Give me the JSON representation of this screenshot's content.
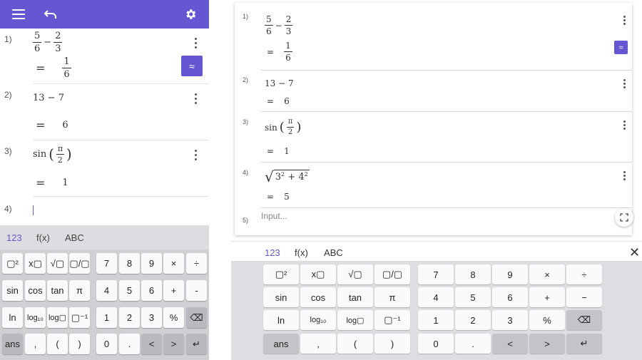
{
  "colors": {
    "accent": "#6557d2",
    "key_bg": "#fafafa",
    "key_dark": "#b9b9bf"
  },
  "icons": {
    "menu": "hamburger-icon",
    "undo": "undo-icon",
    "settings": "gear-icon",
    "more": "kebab-icon",
    "approx": "approx-icon",
    "backspace": "backspace-icon",
    "enter": "enter-icon",
    "expand": "fullscreen-icon",
    "close": "close-icon"
  },
  "mobile": {
    "rows": [
      {
        "num": "1)",
        "equals": "=",
        "expr": {
          "a_num": "5",
          "a_den": "6",
          "op": "−",
          "b_num": "2",
          "b_den": "3"
        },
        "result": {
          "num": "1",
          "den": "6"
        }
      },
      {
        "num": "2)",
        "equals": "=",
        "expr": "13 − 7",
        "result": "6"
      },
      {
        "num": "3)",
        "equals": "=",
        "expr": {
          "fn": "sin",
          "num": "π",
          "den": "2"
        },
        "result": "1"
      },
      {
        "num": "4)"
      }
    ],
    "approx_label": "≈",
    "tabs": [
      "123",
      "f(x)",
      "ABC"
    ],
    "keys": {
      "r1": [
        "▢²",
        "x▢",
        "√▢",
        "▢/▢",
        "7",
        "8",
        "9",
        "×",
        "÷"
      ],
      "r2": [
        "sin",
        "cos",
        "tan",
        "π",
        "4",
        "5",
        "6",
        "+",
        "-"
      ],
      "r3": [
        "ln",
        "log₁₀",
        "log▢",
        "▢⁻¹",
        "1",
        "2",
        "3",
        "%",
        "⌫"
      ],
      "r4": [
        "ans",
        ",",
        "(",
        ")",
        "0",
        ".",
        "<",
        ">",
        "↵"
      ]
    }
  },
  "desktop": {
    "rows": [
      {
        "num": "1)",
        "equals": "=",
        "expr": {
          "a_num": "5",
          "a_den": "6",
          "op": "−",
          "b_num": "2",
          "b_den": "3"
        },
        "result": {
          "num": "1",
          "den": "6"
        }
      },
      {
        "num": "2)",
        "equals": "=",
        "expr": "13 − 7",
        "result": "6"
      },
      {
        "num": "3)",
        "equals": "=",
        "expr": {
          "fn": "sin",
          "num": "π",
          "den": "2"
        },
        "result": "1"
      },
      {
        "num": "4)",
        "equals": "=",
        "expr": {
          "a": "3",
          "b": "4",
          "exp": "2",
          "op": "+"
        },
        "result": "5"
      },
      {
        "num": "5)"
      }
    ],
    "approx_label": "≈",
    "input_placeholder": "Input...",
    "tabs": [
      "123",
      "f(x)",
      "ABC"
    ],
    "close_label": "✕",
    "keys": {
      "r1": [
        "▢²",
        "x▢",
        "√▢",
        "▢/▢",
        "7",
        "8",
        "9",
        "×",
        "÷"
      ],
      "r2": [
        "sin",
        "cos",
        "tan",
        "π",
        "4",
        "5",
        "6",
        "+",
        "−"
      ],
      "r3": [
        "ln",
        "log₁₀",
        "log▢",
        "▢⁻¹",
        "1",
        "2",
        "3",
        "%",
        "⌫"
      ],
      "r4": [
        "ans",
        ",",
        "(",
        ")",
        "0",
        ".",
        "<",
        ">",
        "↵"
      ]
    }
  }
}
